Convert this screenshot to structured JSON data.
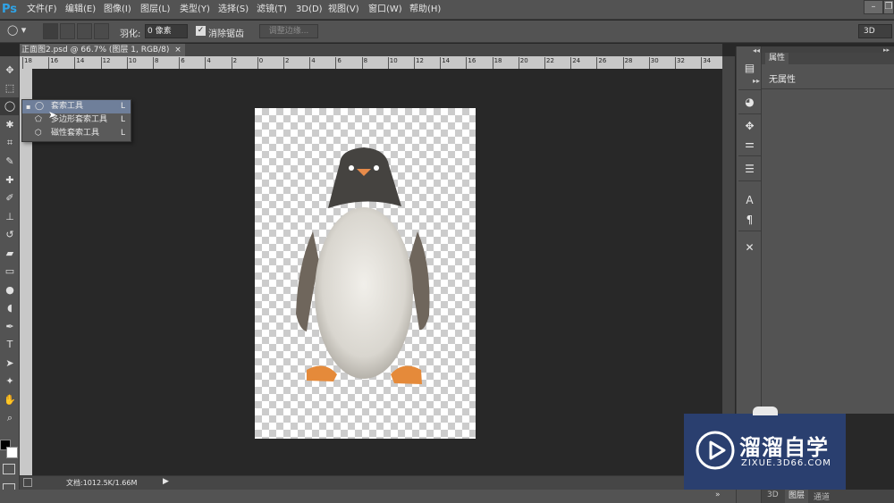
{
  "app": {
    "logo": "Ps"
  },
  "menu": [
    "文件(F)",
    "编辑(E)",
    "图像(I)",
    "图层(L)",
    "类型(Y)",
    "选择(S)",
    "滤镜(T)",
    "3D(D)",
    "视图(V)",
    "窗口(W)",
    "帮助(H)"
  ],
  "options": {
    "feather_label": "羽化:",
    "feather_value": "0 像素",
    "antialias_label": "消除锯齿",
    "refine_edge": "调整边缘...",
    "workspace": "3D",
    "antialias_checked": true
  },
  "doc_tab": {
    "title": "正面图2.psd @ 66.7% (图层 1, RGB/8)",
    "close": "×"
  },
  "ruler_ticks": [
    "18",
    "16",
    "14",
    "12",
    "10",
    "8",
    "6",
    "4",
    "2",
    "0",
    "2",
    "4",
    "6",
    "8",
    "10",
    "12",
    "14",
    "16",
    "18",
    "20",
    "22",
    "24",
    "26",
    "28",
    "30",
    "32",
    "34"
  ],
  "flyout": {
    "items": [
      {
        "label": "套索工具",
        "key": "L",
        "active": true
      },
      {
        "label": "多边形套索工具",
        "key": "L",
        "active": false
      },
      {
        "label": "磁性套索工具",
        "key": "L",
        "active": false
      }
    ]
  },
  "status": {
    "doc_size": "文档:1012.5K/1.66M"
  },
  "properties": {
    "tab": "属性",
    "content": "无属性"
  },
  "bottom_tabs": [
    "3D",
    "图层",
    "通道"
  ],
  "watermark": {
    "brand": "溜溜自学",
    "url": "ZIXUE.3D66.COM"
  },
  "icons": {
    "tools": [
      "move-icon",
      "marquee-icon",
      "lasso-icon",
      "magic-wand-icon",
      "crop-icon",
      "eyedropper-icon",
      "healing-icon",
      "brush-icon",
      "stamp-icon",
      "history-brush-icon",
      "eraser-icon",
      "gradient-icon",
      "blur-icon",
      "dodge-icon",
      "pen-icon",
      "type-icon",
      "path-select-icon",
      "shape-icon",
      "hand-icon",
      "zoom-icon"
    ]
  }
}
